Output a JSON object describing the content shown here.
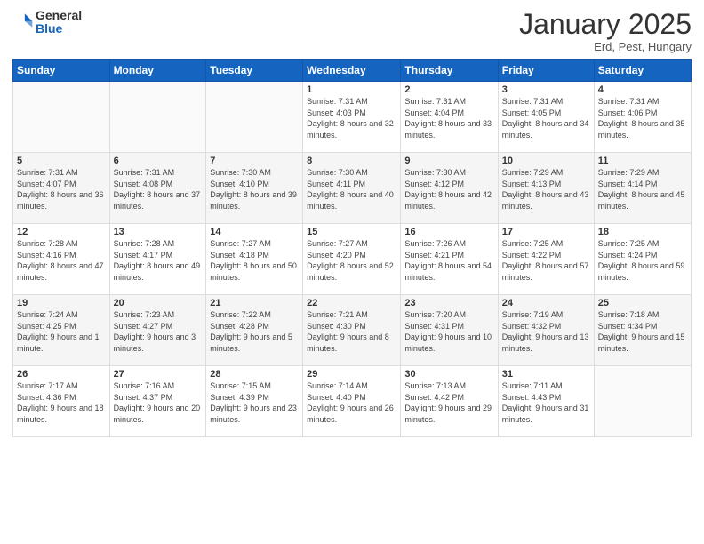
{
  "header": {
    "logo_general": "General",
    "logo_blue": "Blue",
    "month": "January 2025",
    "location": "Erd, Pest, Hungary"
  },
  "weekdays": [
    "Sunday",
    "Monday",
    "Tuesday",
    "Wednesday",
    "Thursday",
    "Friday",
    "Saturday"
  ],
  "weeks": [
    [
      {
        "day": "",
        "info": ""
      },
      {
        "day": "",
        "info": ""
      },
      {
        "day": "",
        "info": ""
      },
      {
        "day": "1",
        "info": "Sunrise: 7:31 AM\nSunset: 4:03 PM\nDaylight: 8 hours and 32 minutes."
      },
      {
        "day": "2",
        "info": "Sunrise: 7:31 AM\nSunset: 4:04 PM\nDaylight: 8 hours and 33 minutes."
      },
      {
        "day": "3",
        "info": "Sunrise: 7:31 AM\nSunset: 4:05 PM\nDaylight: 8 hours and 34 minutes."
      },
      {
        "day": "4",
        "info": "Sunrise: 7:31 AM\nSunset: 4:06 PM\nDaylight: 8 hours and 35 minutes."
      }
    ],
    [
      {
        "day": "5",
        "info": "Sunrise: 7:31 AM\nSunset: 4:07 PM\nDaylight: 8 hours and 36 minutes."
      },
      {
        "day": "6",
        "info": "Sunrise: 7:31 AM\nSunset: 4:08 PM\nDaylight: 8 hours and 37 minutes."
      },
      {
        "day": "7",
        "info": "Sunrise: 7:30 AM\nSunset: 4:10 PM\nDaylight: 8 hours and 39 minutes."
      },
      {
        "day": "8",
        "info": "Sunrise: 7:30 AM\nSunset: 4:11 PM\nDaylight: 8 hours and 40 minutes."
      },
      {
        "day": "9",
        "info": "Sunrise: 7:30 AM\nSunset: 4:12 PM\nDaylight: 8 hours and 42 minutes."
      },
      {
        "day": "10",
        "info": "Sunrise: 7:29 AM\nSunset: 4:13 PM\nDaylight: 8 hours and 43 minutes."
      },
      {
        "day": "11",
        "info": "Sunrise: 7:29 AM\nSunset: 4:14 PM\nDaylight: 8 hours and 45 minutes."
      }
    ],
    [
      {
        "day": "12",
        "info": "Sunrise: 7:28 AM\nSunset: 4:16 PM\nDaylight: 8 hours and 47 minutes."
      },
      {
        "day": "13",
        "info": "Sunrise: 7:28 AM\nSunset: 4:17 PM\nDaylight: 8 hours and 49 minutes."
      },
      {
        "day": "14",
        "info": "Sunrise: 7:27 AM\nSunset: 4:18 PM\nDaylight: 8 hours and 50 minutes."
      },
      {
        "day": "15",
        "info": "Sunrise: 7:27 AM\nSunset: 4:20 PM\nDaylight: 8 hours and 52 minutes."
      },
      {
        "day": "16",
        "info": "Sunrise: 7:26 AM\nSunset: 4:21 PM\nDaylight: 8 hours and 54 minutes."
      },
      {
        "day": "17",
        "info": "Sunrise: 7:25 AM\nSunset: 4:22 PM\nDaylight: 8 hours and 57 minutes."
      },
      {
        "day": "18",
        "info": "Sunrise: 7:25 AM\nSunset: 4:24 PM\nDaylight: 8 hours and 59 minutes."
      }
    ],
    [
      {
        "day": "19",
        "info": "Sunrise: 7:24 AM\nSunset: 4:25 PM\nDaylight: 9 hours and 1 minute."
      },
      {
        "day": "20",
        "info": "Sunrise: 7:23 AM\nSunset: 4:27 PM\nDaylight: 9 hours and 3 minutes."
      },
      {
        "day": "21",
        "info": "Sunrise: 7:22 AM\nSunset: 4:28 PM\nDaylight: 9 hours and 5 minutes."
      },
      {
        "day": "22",
        "info": "Sunrise: 7:21 AM\nSunset: 4:30 PM\nDaylight: 9 hours and 8 minutes."
      },
      {
        "day": "23",
        "info": "Sunrise: 7:20 AM\nSunset: 4:31 PM\nDaylight: 9 hours and 10 minutes."
      },
      {
        "day": "24",
        "info": "Sunrise: 7:19 AM\nSunset: 4:32 PM\nDaylight: 9 hours and 13 minutes."
      },
      {
        "day": "25",
        "info": "Sunrise: 7:18 AM\nSunset: 4:34 PM\nDaylight: 9 hours and 15 minutes."
      }
    ],
    [
      {
        "day": "26",
        "info": "Sunrise: 7:17 AM\nSunset: 4:36 PM\nDaylight: 9 hours and 18 minutes."
      },
      {
        "day": "27",
        "info": "Sunrise: 7:16 AM\nSunset: 4:37 PM\nDaylight: 9 hours and 20 minutes."
      },
      {
        "day": "28",
        "info": "Sunrise: 7:15 AM\nSunset: 4:39 PM\nDaylight: 9 hours and 23 minutes."
      },
      {
        "day": "29",
        "info": "Sunrise: 7:14 AM\nSunset: 4:40 PM\nDaylight: 9 hours and 26 minutes."
      },
      {
        "day": "30",
        "info": "Sunrise: 7:13 AM\nSunset: 4:42 PM\nDaylight: 9 hours and 29 minutes."
      },
      {
        "day": "31",
        "info": "Sunrise: 7:11 AM\nSunset: 4:43 PM\nDaylight: 9 hours and 31 minutes."
      },
      {
        "day": "",
        "info": ""
      }
    ]
  ]
}
